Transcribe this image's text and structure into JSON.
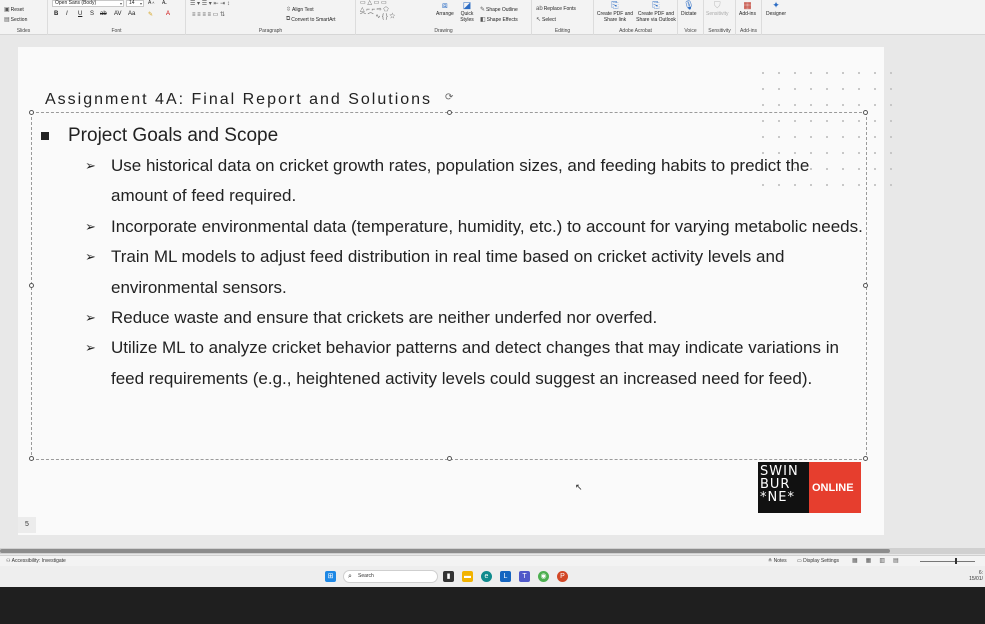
{
  "ribbon": {
    "slides_group": {
      "label": "Slides",
      "reset_label": "Reset",
      "section_label": "Section"
    },
    "font_group": {
      "label": "Font",
      "font_name": "Open Sans (Body)",
      "font_size": "14",
      "bold": "B",
      "italic": "I",
      "underline": "U",
      "strike": "S",
      "shadow": "ab",
      "spacing": "AV",
      "case": "Aa"
    },
    "paragraph_group": {
      "label": "Paragraph",
      "align_text": "Align Text",
      "convert_smartart": "Convert to SmartArt"
    },
    "drawing_group": {
      "label": "Drawing",
      "arrange": "Arrange",
      "quick_styles": "Quick Styles",
      "shape_outline": "Shape Outline",
      "shape_effects": "Shape Effects"
    },
    "editing_group": {
      "label": "Editing",
      "replace_fonts": "Replace Fonts",
      "select": "Select"
    },
    "acrobat_group": {
      "label": "Adobe Acrobat",
      "create_pdf_link": "Create PDF and Share link",
      "create_pdf_outlook": "Create PDF and Share via Outlook"
    },
    "voice_group": {
      "label": "Voice",
      "dictate": "Dictate"
    },
    "sensitivity_group": {
      "label": "Sensitivity",
      "sensitivity": "Sensitivity"
    },
    "addins_group": {
      "label": "Add-ins",
      "addins": "Add-ins"
    },
    "designer": "Designer"
  },
  "slide": {
    "title": "Assignment 4A: Final Report and Solutions",
    "heading": "Project Goals and Scope",
    "bullets": [
      "Use historical data on cricket growth rates, population sizes, and feeding habits to predict the amount of feed required.",
      "Incorporate environmental data (temperature, humidity, etc.) to account for varying metabolic needs.",
      "Train ML models to adjust feed distribution in real time based on cricket activity levels and environmental sensors.",
      "Reduce waste and ensure that crickets are neither underfed nor overfed.",
      "Utilize ML to analyze cricket behavior patterns and detect changes that may indicate variations in feed requirements (e.g., heightened activity levels could suggest an increased need for feed)."
    ],
    "bullet_glyph": "➢",
    "logo": {
      "lines": [
        "SWIN",
        "BUR",
        "*NE*"
      ],
      "online": "ONLINE"
    },
    "slide_number": "5"
  },
  "status": {
    "accessibility": "Accessibility: Investigate",
    "notes": "Notes",
    "display_settings": "Display Settings"
  },
  "taskbar": {
    "search_placeholder": "Search",
    "clock_time": "6:",
    "clock_date": "15/01/"
  },
  "colors": {
    "logo_red": "#e63e2e",
    "logo_black": "#111111",
    "taskbar_bg": "#eeeeee"
  }
}
